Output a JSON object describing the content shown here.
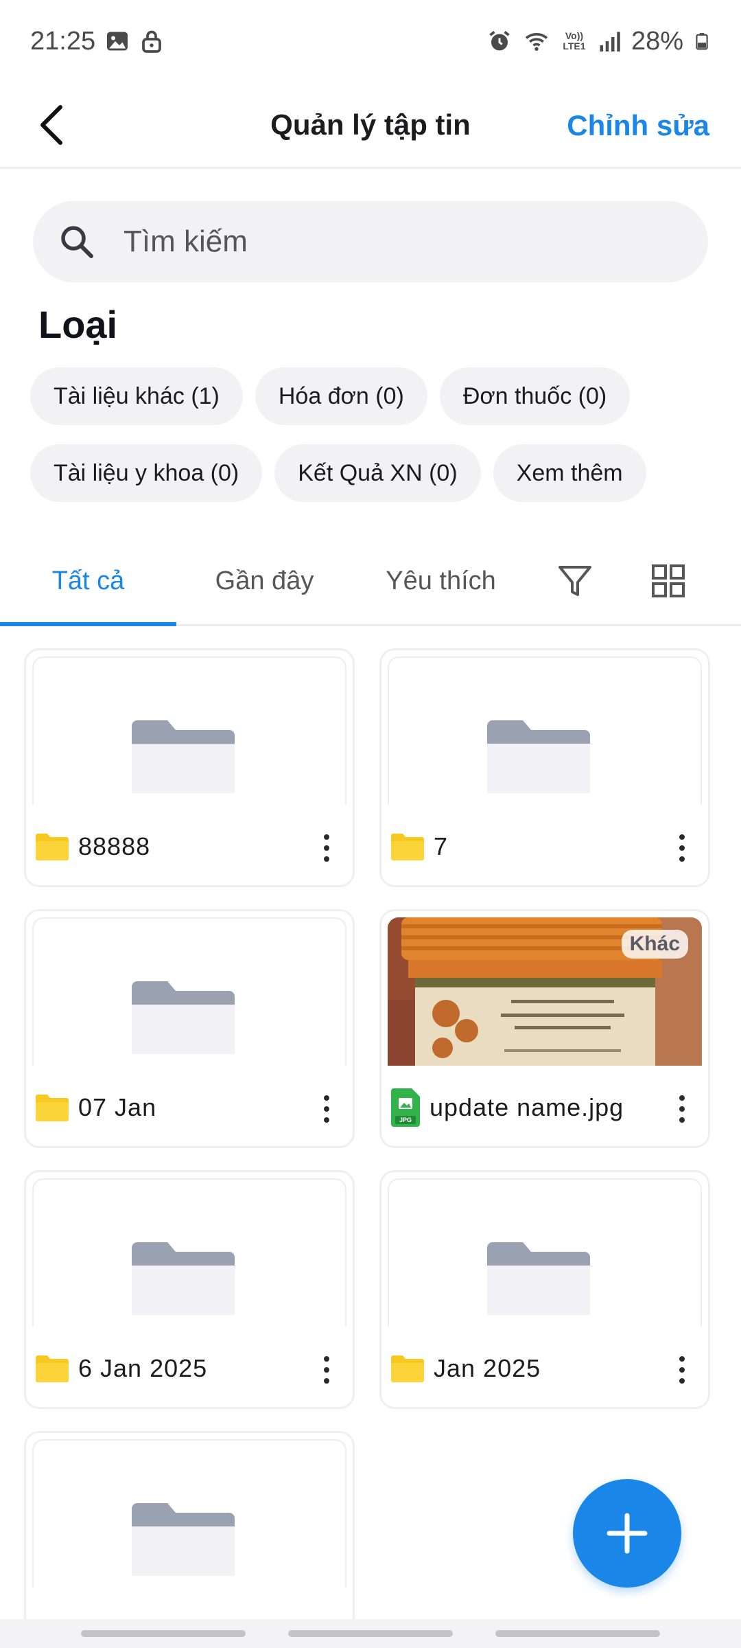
{
  "status_bar": {
    "time": "21:25",
    "battery": "28%",
    "network_label": "Vo)) LTE1"
  },
  "header": {
    "title": "Quản lý tập tin",
    "edit_label": "Chỉnh sửa"
  },
  "search": {
    "placeholder": "Tìm kiếm"
  },
  "categories": {
    "title": "Loại",
    "chips": [
      "Tài liệu khác (1)",
      "Hóa đơn (0)",
      "Đơn thuốc (0)",
      "Tài liệu y khoa (0)",
      "Kết Quả XN (0)",
      "Xem thêm"
    ]
  },
  "tabs": [
    {
      "label": "Tất cả",
      "active": true
    },
    {
      "label": "Gần đây",
      "active": false
    },
    {
      "label": "Yêu thích",
      "active": false
    }
  ],
  "items": [
    {
      "name": "88888",
      "type": "folder"
    },
    {
      "name": "7",
      "type": "folder"
    },
    {
      "name": "07 Jan",
      "type": "folder"
    },
    {
      "name": "update name.jpg",
      "type": "image",
      "badge": "Khác",
      "file_tag": "JPG"
    },
    {
      "name": "6 Jan 2025",
      "type": "folder"
    },
    {
      "name": "Jan 2025",
      "type": "folder"
    },
    {
      "name": "",
      "type": "folder"
    }
  ],
  "colors": {
    "accent": "#1a86e8",
    "folder_yellow": "#f7c820",
    "folder_gray": "#9aa1b0",
    "jpg_green": "#2fb34a"
  },
  "icons": {
    "back": "chevron-left-icon",
    "search": "search-icon",
    "filter": "filter-icon",
    "grid": "grid-view-icon",
    "more": "more-vertical-icon",
    "add": "plus-icon"
  }
}
